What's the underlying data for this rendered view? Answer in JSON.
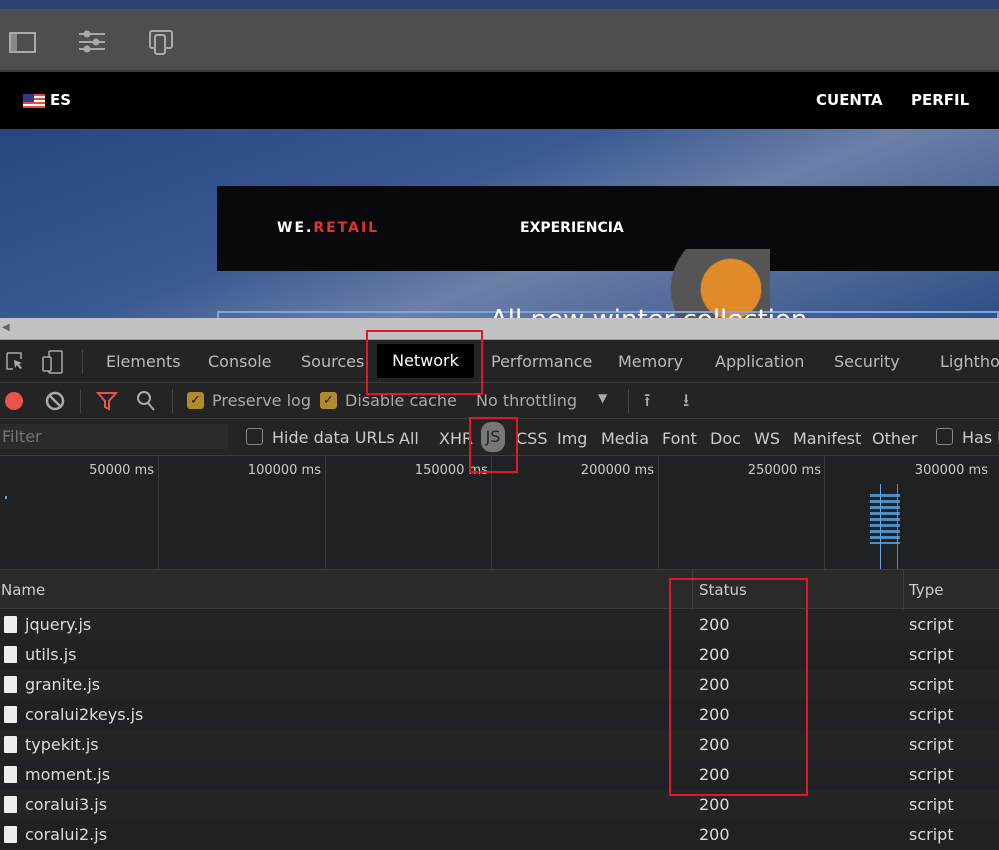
{
  "aem_toolbar": {
    "icons": [
      "side-panel-icon",
      "sliders-icon",
      "emulator-icon"
    ]
  },
  "site": {
    "language": "ES",
    "nav_right": [
      "CUENTA",
      "PERFIL"
    ],
    "logo_we": "WE.",
    "logo_retail": "RETAIL",
    "nav_item": "EXPERIENCIA",
    "hero_text": "All new winter collection",
    "brand_color": "#e1332a"
  },
  "devtools": {
    "tabs": [
      "Elements",
      "Console",
      "Sources",
      "Network",
      "Performance",
      "Memory",
      "Application",
      "Security",
      "Lighthouse"
    ],
    "active_tab": "Network",
    "toolbar": {
      "preserve_log": "Preserve log",
      "preserve_log_checked": true,
      "disable_cache": "Disable cache",
      "disable_cache_checked": true,
      "throttling": "No throttling"
    },
    "filter": {
      "placeholder": "Filter",
      "hide_data_urls": "Hide data URLs",
      "types": [
        "All",
        "XHR",
        "JS",
        "CSS",
        "Img",
        "Media",
        "Font",
        "Doc",
        "WS",
        "Manifest",
        "Other"
      ],
      "active_type": "JS",
      "has_blocked": "Has b"
    },
    "timeline_ticks": [
      "50000 ms",
      "100000 ms",
      "150000 ms",
      "200000 ms",
      "250000 ms",
      "300000 ms"
    ],
    "columns": [
      "Name",
      "Status",
      "Type"
    ],
    "rows": [
      {
        "name": "jquery.js",
        "status": "200",
        "type": "script"
      },
      {
        "name": "utils.js",
        "status": "200",
        "type": "script"
      },
      {
        "name": "granite.js",
        "status": "200",
        "type": "script"
      },
      {
        "name": "coralui2keys.js",
        "status": "200",
        "type": "script"
      },
      {
        "name": "typekit.js",
        "status": "200",
        "type": "script"
      },
      {
        "name": "moment.js",
        "status": "200",
        "type": "script"
      },
      {
        "name": "coralui3.js",
        "status": "200",
        "type": "script"
      },
      {
        "name": "coralui2.js",
        "status": "200",
        "type": "script"
      }
    ]
  }
}
